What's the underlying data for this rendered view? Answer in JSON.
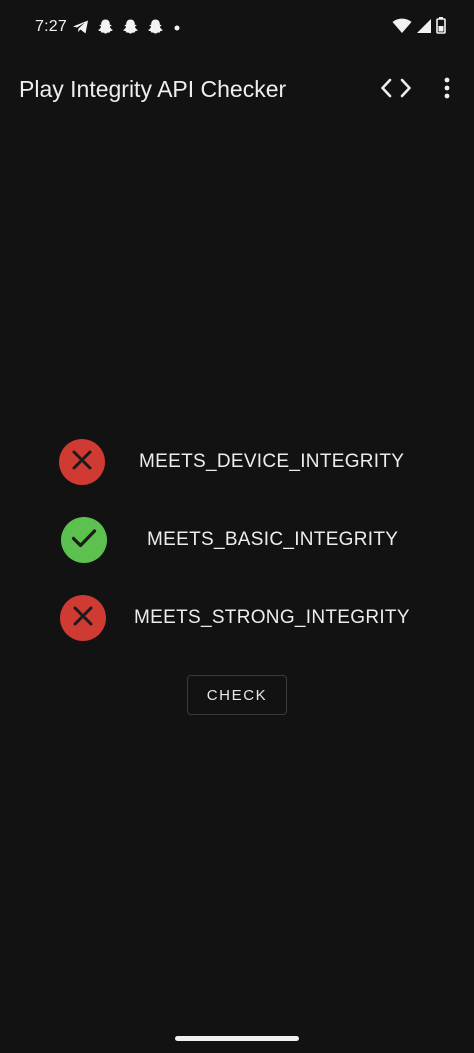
{
  "status_bar": {
    "time": "7:27",
    "notification_icons": [
      "telegram-icon",
      "snapchat-icon",
      "snapchat-icon",
      "snapchat-icon",
      "dot-icon"
    ],
    "system_icons": [
      "wifi-icon",
      "signal-icon",
      "battery-icon"
    ]
  },
  "app_bar": {
    "title": "Play Integrity API Checker",
    "actions": [
      "code-icon",
      "more-vert-icon"
    ]
  },
  "checks": [
    {
      "label": "MEETS_DEVICE_INTEGRITY",
      "status": "fail",
      "icon": "close-icon",
      "color": "#cf3a32"
    },
    {
      "label": "MEETS_BASIC_INTEGRITY",
      "status": "pass",
      "icon": "checkmark-icon",
      "color": "#5cc14f"
    },
    {
      "label": "MEETS_STRONG_INTEGRITY",
      "status": "fail",
      "icon": "close-icon",
      "color": "#cf3a32"
    }
  ],
  "check_button": {
    "label": "CHECK"
  },
  "colors": {
    "background": "#121212",
    "text": "#eeeeee",
    "fail": "#cf3a32",
    "pass": "#5cc14f"
  }
}
